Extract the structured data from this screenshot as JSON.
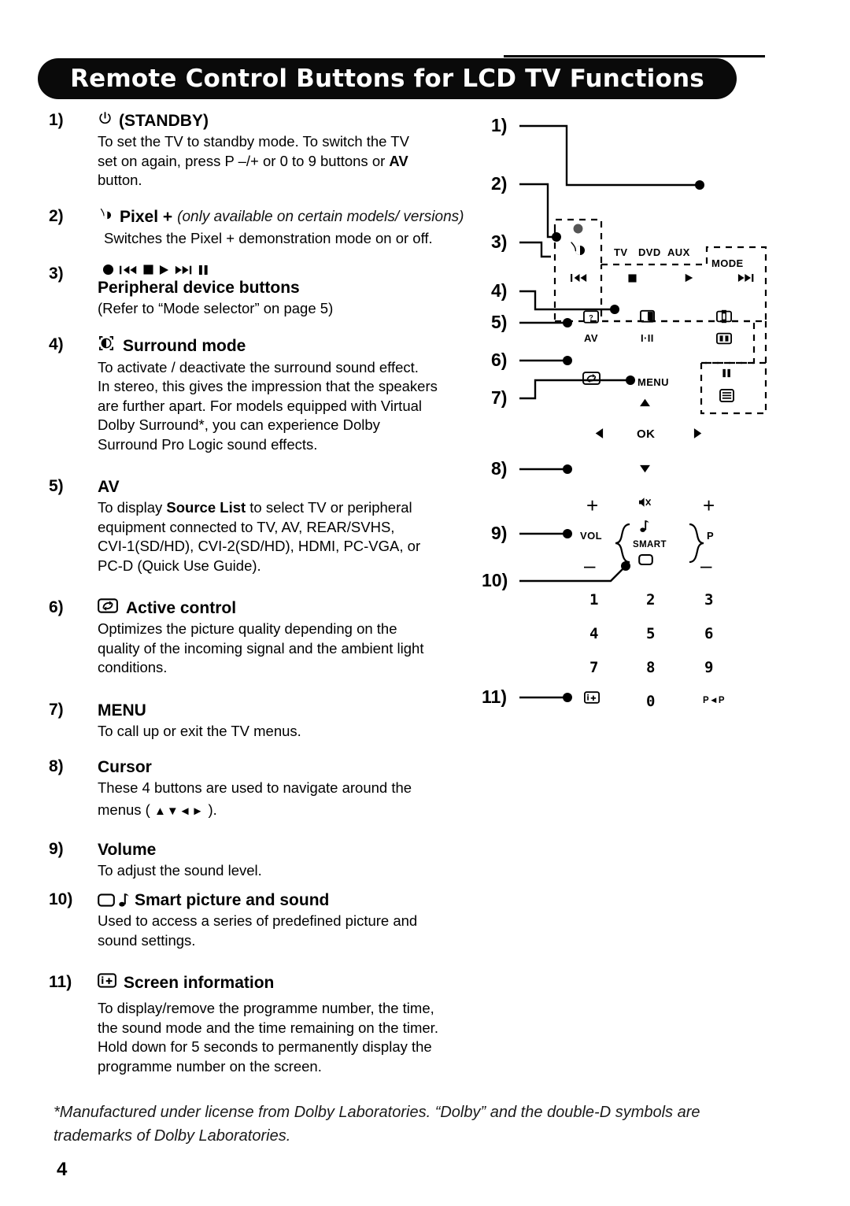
{
  "header": {
    "title": "Remote Control Buttons for LCD TV Functions"
  },
  "items": [
    {
      "number": "1)",
      "icon": "standby-power-icon",
      "title": "(STANDBY)",
      "desc": "To set the TV to standby mode. To switch the TV set on again, press P –/+ or 0 to 9 buttons or AV button."
    },
    {
      "number": "2)",
      "icon": "pixel-plus-icon",
      "title": "Pixel +",
      "note": "(only available on certain models/ versions)",
      "desc": "Switches the Pixel + demonstration mode on or off."
    },
    {
      "number": "3)",
      "icon": "peripheral-transport-icons",
      "title": "Peripheral device buttons",
      "desc": "(Refer to “Mode selector” on page 5)"
    },
    {
      "number": "4)",
      "icon": "surround-mode-icon",
      "title": "Surround mode",
      "desc": "To activate / deactivate the surround sound effect. In stereo, this gives the impression that the speakers are further apart. For models equipped with Virtual Dolby Surround*, you can experience Dolby Surround Pro Logic sound effects."
    },
    {
      "number": "5)",
      "icon": "",
      "title": "AV",
      "desc": "To display Source List to select TV or peripheral equipment connected to TV, AV, REAR/SVHS, CVI-1(SD/HD), CVI-2(SD/HD), HDMI, PC-VGA, or PC-D (Quick Use Guide)."
    },
    {
      "number": "6)",
      "icon": "active-control-icon",
      "title": "Active control",
      "desc": "Optimizes the picture quality depending on the quality of the incoming signal and the ambient light conditions."
    },
    {
      "number": "7)",
      "icon": "",
      "title": "MENU",
      "desc": "To call up or exit the TV menus."
    },
    {
      "number": "8)",
      "icon": "",
      "title": "Cursor",
      "desc": "These 4 buttons are used to navigate around the menus ( ▲▼◄► )."
    },
    {
      "number": "9)",
      "icon": "",
      "title": "Volume",
      "desc": "To adjust the sound level."
    },
    {
      "number": "10)",
      "icon": "smart-picture-sound-icon",
      "title": "Smart picture and sound",
      "desc": "Used to access a series of predefined picture and sound settings."
    },
    {
      "number": "11)",
      "icon": "screen-information-icon",
      "title": "Screen information",
      "desc": "To display/remove the programme number, the time, the sound mode and the time remaining on the timer. Hold down for 5 seconds to permanently display the programme number on the screen."
    }
  ],
  "item1": {
    "number": "1)",
    "title": "(STANDBY)",
    "line1": "To set the TV to standby mode. To switch the TV",
    "line2a": "set on again, press P –/+ or 0 to 9 buttons or ",
    "line2b": "AV",
    "line3": "button."
  },
  "item2": {
    "number": "2)",
    "title": "Pixel +",
    "note": "(only available on certain models/ versions)",
    "desc": "Switches the Pixel + demonstration mode on or off."
  },
  "item3": {
    "number": "3)",
    "title": "Peripheral device buttons",
    "desc": "(Refer to “Mode selector” on page 5)"
  },
  "item4": {
    "number": "4)",
    "title": "Surround mode",
    "line1": "To activate / deactivate the surround sound effect.",
    "line2": "In stereo, this gives the impression that the speakers",
    "line3": "are further apart. For models equipped with Virtual",
    "line4": "Dolby Surround*, you can experience Dolby",
    "line5": "Surround Pro Logic sound effects."
  },
  "item5": {
    "number": "5)",
    "title": "AV",
    "line1a": "To display ",
    "line1b": "Source List",
    "line1c": " to select TV or peripheral",
    "line2": "equipment connected to TV, AV, REAR/SVHS,",
    "line3": "CVI-1(SD/HD), CVI-2(SD/HD), HDMI, PC-VGA, or",
    "line4": "PC-D (Quick Use Guide)."
  },
  "item6": {
    "number": "6)",
    "title": "Active control",
    "line1": "Optimizes the picture quality depending on the",
    "line2": "quality of the incoming signal and the ambient light",
    "line3": "conditions."
  },
  "item7": {
    "number": "7)",
    "title": "MENU",
    "line1": "To call up or exit the TV menus."
  },
  "item8": {
    "number": "8)",
    "title": "Cursor",
    "line1": "These 4 buttons are used to navigate around the",
    "line2a": "menus ( ",
    "line2b": "▲▼◄►",
    "line2c": " )."
  },
  "item9": {
    "number": "9)",
    "title": "Volume",
    "line1": "To adjust the sound level."
  },
  "item10": {
    "number": "10)",
    "title": "Smart picture and sound",
    "line1": "Used to access a series of predefined picture and",
    "line2": "sound settings."
  },
  "item11": {
    "number": "11)",
    "title": "Screen information",
    "line1": "To display/remove the programme number, the time,",
    "line2": "the sound mode and the time remaining on the timer.",
    "line3": "Hold down for 5 seconds to permanently display the",
    "line4": "programme number on the screen."
  },
  "footnote": {
    "line1": "*Manufactured under license from Dolby Laboratories. “Dolby” and the double-D symbols are",
    "line2": "trademarks of Dolby Laboratories."
  },
  "page_number": "4",
  "diagram": {
    "callouts": [
      "1)",
      "2)",
      "3)",
      "4)",
      "5)",
      "6)",
      "7)",
      "8)",
      "9)",
      "10)",
      "11)"
    ],
    "mode_row": {
      "tv": "TV",
      "dvd": "DVD",
      "aux": "AUX",
      "mode": "MODE"
    },
    "transport": [
      "prev-track-icon",
      "stop-icon",
      "play-icon",
      "next-track-icon"
    ],
    "source_row": {
      "av": "AV",
      "sound_mode": "I·II"
    },
    "menu_label": "MENU",
    "ok_label": "OK",
    "vol_label": "VOL",
    "p_label": "P",
    "smart_label": "SMART",
    "plus": "+",
    "minus": "–",
    "keypad": [
      [
        "1",
        "2",
        "3"
      ],
      [
        "4",
        "5",
        "6"
      ],
      [
        "7",
        "8",
        "9"
      ]
    ],
    "keypad_bottom": {
      "info": "screen-information-icon",
      "zero": "0",
      "pip": "P◄P"
    }
  },
  "colors": {
    "ink": "#000000",
    "paper": "#ffffff",
    "header_bg": "#0a0a0a",
    "header_fg": "#ffffff"
  }
}
